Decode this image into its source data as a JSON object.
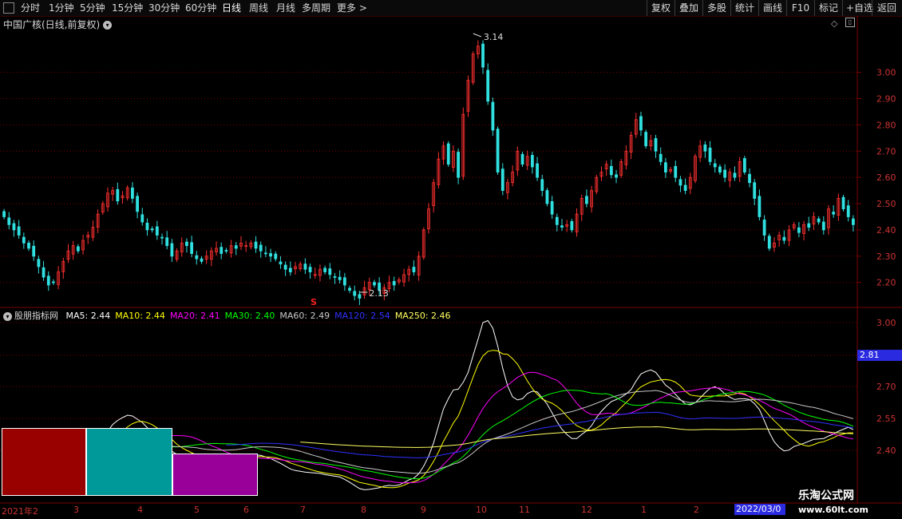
{
  "toolbar": {
    "left": [
      "分时",
      "1分钟",
      "5分钟",
      "15分钟",
      "30分钟",
      "60分钟",
      "日线",
      "周线",
      "月线",
      "多周期",
      "更多"
    ],
    "active": "日线",
    "right": [
      "复权",
      "叠加",
      "多股",
      "统计",
      "画线",
      "F10",
      "标记",
      "+自选",
      "返回"
    ]
  },
  "main_title": "中国广核(日线,前复权)",
  "indicator_name": "股朋指标网",
  "ma_legend": [
    {
      "label": "MA5: 2.44",
      "color": "#ffffff"
    },
    {
      "label": "MA10: 2.44",
      "color": "#ffff00"
    },
    {
      "label": "MA20: 2.41",
      "color": "#ff00ff"
    },
    {
      "label": "MA30: 2.40",
      "color": "#00ff00"
    },
    {
      "label": "MA60: 2.49",
      "color": "#c8c8c8"
    },
    {
      "label": "MA120: 2.54",
      "color": "#3030ff"
    },
    {
      "label": "MA250: 2.46",
      "color": "#ffff60"
    }
  ],
  "price_axis_main": [
    "3.00",
    "2.90",
    "2.80",
    "2.70",
    "2.60",
    "2.50",
    "2.40",
    "2.30",
    "2.20"
  ],
  "price_axis_sub": [
    "3.00",
    "2.70",
    "2.55",
    "2.40"
  ],
  "price_tag": "2.81",
  "annotations": {
    "high": "3.14",
    "low": "2.13",
    "signal": "S"
  },
  "months": [
    "2021年2",
    "3",
    "4",
    "5",
    "6",
    "7",
    "8",
    "9",
    "10",
    "11",
    "12",
    "1",
    "2"
  ],
  "date_box": "2022/03/0",
  "watermark": {
    "line1": "乐淘公式网",
    "line2": "www.60lt.com"
  },
  "colors": {
    "up": "#ff3030",
    "down": "#30e0e0",
    "grid": "#7a0000",
    "block1": "#990000",
    "block2": "#009999",
    "block3": "#990099"
  },
  "chart_data": {
    "type": "candlestick",
    "closes": [
      2.45,
      2.42,
      2.4,
      2.38,
      2.35,
      2.33,
      2.3,
      2.26,
      2.22,
      2.19,
      2.2,
      2.24,
      2.28,
      2.32,
      2.34,
      2.32,
      2.36,
      2.38,
      2.41,
      2.46,
      2.5,
      2.54,
      2.55,
      2.51,
      2.53,
      2.56,
      2.52,
      2.47,
      2.43,
      2.4,
      2.4,
      2.38,
      2.37,
      2.34,
      2.3,
      2.32,
      2.35,
      2.34,
      2.31,
      2.29,
      2.28,
      2.3,
      2.32,
      2.33,
      2.31,
      2.32,
      2.34,
      2.33,
      2.35,
      2.34,
      2.35,
      2.33,
      2.32,
      2.31,
      2.3,
      2.29,
      2.27,
      2.25,
      2.24,
      2.26,
      2.27,
      2.25,
      2.24,
      2.23,
      2.25,
      2.24,
      2.23,
      2.22,
      2.21,
      2.19,
      2.17,
      2.15,
      2.14,
      2.18,
      2.2,
      2.19,
      2.17,
      2.18,
      2.2,
      2.19,
      2.21,
      2.23,
      2.25,
      2.24,
      2.3,
      2.4,
      2.48,
      2.58,
      2.67,
      2.72,
      2.65,
      2.7,
      2.6,
      2.84,
      2.97,
      3.07,
      3.1,
      3.02,
      2.89,
      2.78,
      2.62,
      2.55,
      2.58,
      2.62,
      2.7,
      2.65,
      2.68,
      2.64,
      2.6,
      2.55,
      2.5,
      2.46,
      2.42,
      2.41,
      2.42,
      2.4,
      2.46,
      2.52,
      2.5,
      2.55,
      2.6,
      2.62,
      2.65,
      2.61,
      2.6,
      2.66,
      2.7,
      2.76,
      2.82,
      2.78,
      2.72,
      2.74,
      2.7,
      2.66,
      2.62,
      2.63,
      2.6,
      2.57,
      2.55,
      2.6,
      2.68,
      2.72,
      2.7,
      2.66,
      2.64,
      2.62,
      2.6,
      2.62,
      2.6,
      2.66,
      2.62,
      2.58,
      2.52,
      2.45,
      2.38,
      2.33,
      2.35,
      2.38,
      2.36,
      2.4,
      2.42,
      2.39,
      2.42,
      2.41,
      2.45,
      2.43,
      2.4,
      2.48,
      2.46,
      2.52,
      2.48,
      2.45,
      2.42
    ],
    "high": 3.14,
    "low": 2.13,
    "ylim": [
      2.12,
      3.16
    ]
  }
}
